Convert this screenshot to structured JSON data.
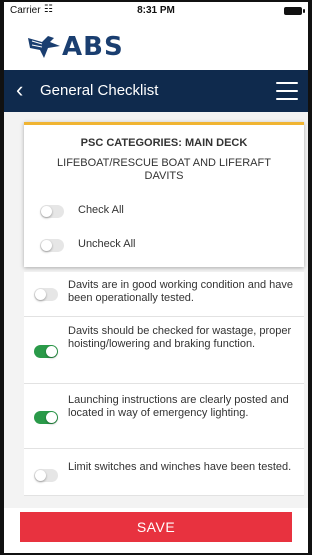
{
  "status_bar": {
    "carrier": "Carrier",
    "time": "8:31 PM"
  },
  "logo": {
    "text": "ABS"
  },
  "header": {
    "title": "General Checklist"
  },
  "card": {
    "category": "PSC CATEGORIES: MAIN DECK",
    "subtitle": "LIFEBOAT/RESCUE BOAT AND LIFERAFT DAVITS",
    "check_all": {
      "label": "Check All",
      "on": false
    },
    "uncheck_all": {
      "label": "Uncheck All",
      "on": false
    }
  },
  "items": [
    {
      "text": "Davits are in good working condition and have been operationally tested.",
      "checked": false
    },
    {
      "text": "Davits should be checked for wastage, proper hoisting/lowering and braking function.",
      "checked": true
    },
    {
      "text": "Launching instructions are clearly posted and located in way of emergency lighting.",
      "checked": true
    },
    {
      "text": "Limit switches and winches have been tested.",
      "checked": false
    }
  ],
  "save_label": "SAVE",
  "colors": {
    "navbar": "#0f2a4d",
    "accent": "#f0b432",
    "toggle_on": "#2a9a49",
    "save": "#e8323f",
    "logo": "#1a3e70"
  },
  "icons": [
    "wifi-icon",
    "battery-icon",
    "eagle-logo-icon",
    "back-chevron-icon",
    "hamburger-menu-icon"
  ]
}
